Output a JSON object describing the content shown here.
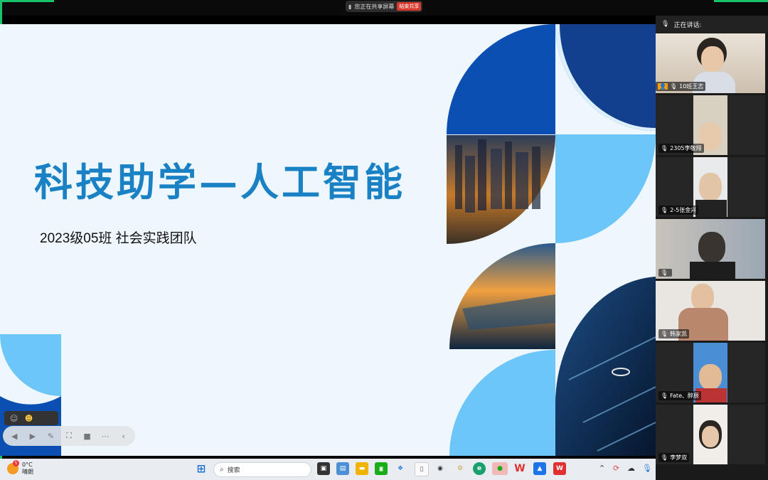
{
  "share_bar": {
    "status_text": "您正在共享屏幕",
    "stop_label": "结束共享"
  },
  "slide": {
    "title": "科技助学—人工智能",
    "subtitle": "2023级05班 社会实践团队"
  },
  "participants_panel": {
    "speaking_label": "正在讲话:",
    "participants": [
      {
        "name": "10班王志"
      },
      {
        "name": "2305李敬翔"
      },
      {
        "name": "2-5张金兴"
      },
      {
        "name": ""
      },
      {
        "name": "韩家凯"
      },
      {
        "name": "Fate、醉辰"
      },
      {
        "name": "李梦双"
      }
    ]
  },
  "taskbar": {
    "weather": {
      "temp": "0°C",
      "condition": "晴朗",
      "badge": "5"
    },
    "search_placeholder": "搜索",
    "apps": [
      "start-menu",
      "task-view",
      "file-explorer",
      "folder",
      "wechat-work",
      "vpn",
      "document",
      "alienware",
      "settings",
      "edge",
      "wechat",
      "wps",
      "meeting",
      "wps-office"
    ]
  },
  "colors": {
    "accent": "#1a82c4",
    "deep_blue": "#0b4fb3",
    "light_blue": "#6cc6f7",
    "share_red": "#d93a2f",
    "green": "#19c36b"
  }
}
